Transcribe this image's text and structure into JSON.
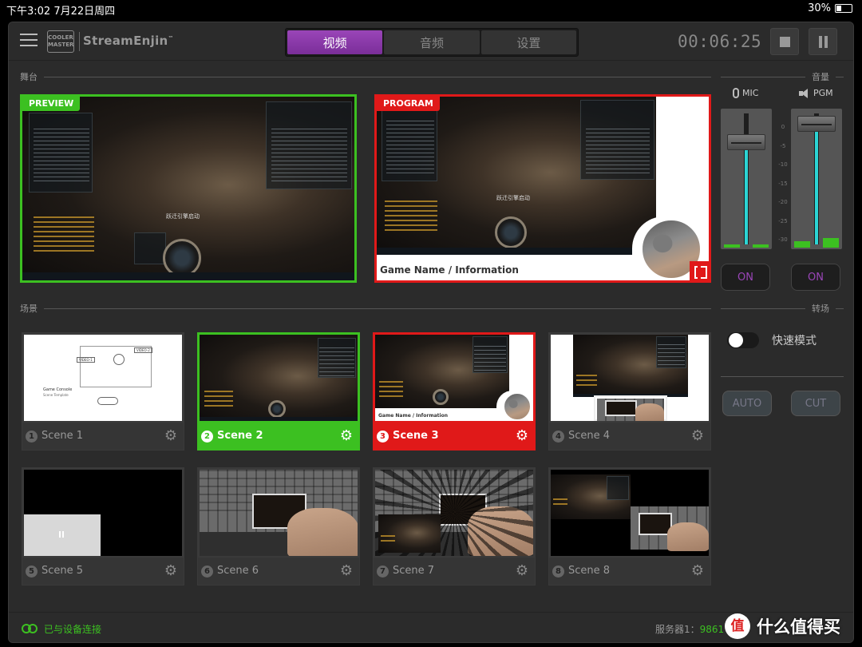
{
  "status_bar": {
    "time": "下午3:02  7月22日周四",
    "battery": "30%"
  },
  "header": {
    "logo_text": "COOLER MASTER",
    "brand": "StreamEnjin",
    "brand_mark": "™",
    "tabs": [
      "视频",
      "音频",
      "设置"
    ],
    "active_tab": 0,
    "timer": "00:06:25"
  },
  "sections": {
    "stage": "舞台",
    "volume": "音量",
    "scenes": "场景",
    "transition": "转场"
  },
  "monitors": {
    "preview_label": "PREVIEW",
    "program_label": "PROGRAM",
    "program_overlay_text": "Game Name / Information",
    "game_notice": "跃迁引擎启动"
  },
  "audio": {
    "mic": {
      "label": "MIC",
      "button": "ON",
      "level": 0.82,
      "fader_position": 0.18
    },
    "pgm": {
      "label": "PGM",
      "button": "ON",
      "level": 0.92,
      "fader_position": 0.02
    },
    "ticks": [
      "0",
      "-5",
      "-10",
      "-15",
      "-20",
      "-25",
      "-30",
      "-inf"
    ]
  },
  "transition": {
    "quick_mode_label": "快速模式",
    "quick_mode_on": false,
    "auto_label": "AUTO",
    "cut_label": "CUT"
  },
  "scenes": [
    {
      "num": "1",
      "name": "Scene 1",
      "thumb": "template",
      "template_title": "Game Console",
      "template_sub": "Scene Template",
      "tag_a": "VIDEO-1",
      "tag_b": "VIDEO-2"
    },
    {
      "num": "2",
      "name": "Scene 2",
      "thumb": "game",
      "state": "preview"
    },
    {
      "num": "3",
      "name": "Scene 3",
      "thumb": "game-frame",
      "state": "program",
      "overlay_text": "Game Name / Information"
    },
    {
      "num": "4",
      "name": "Scene 4",
      "thumb": "game-pip"
    },
    {
      "num": "5",
      "name": "Scene 5",
      "thumb": "media"
    },
    {
      "num": "6",
      "name": "Scene 6",
      "thumb": "camera"
    },
    {
      "num": "7",
      "name": "Scene 7",
      "thumb": "camera-burst"
    },
    {
      "num": "8",
      "name": "Scene 8",
      "thumb": "game-cam"
    }
  ],
  "footer": {
    "connected": "已与设备连接",
    "server_label": "服务器1：",
    "server_value": "9861"
  },
  "watermark": {
    "badge": "值",
    "text": "什么值得买"
  },
  "colors": {
    "accent": "#9a45b8",
    "preview": "#3cc021",
    "program": "#e01919",
    "meter": "#2bd4d4"
  }
}
